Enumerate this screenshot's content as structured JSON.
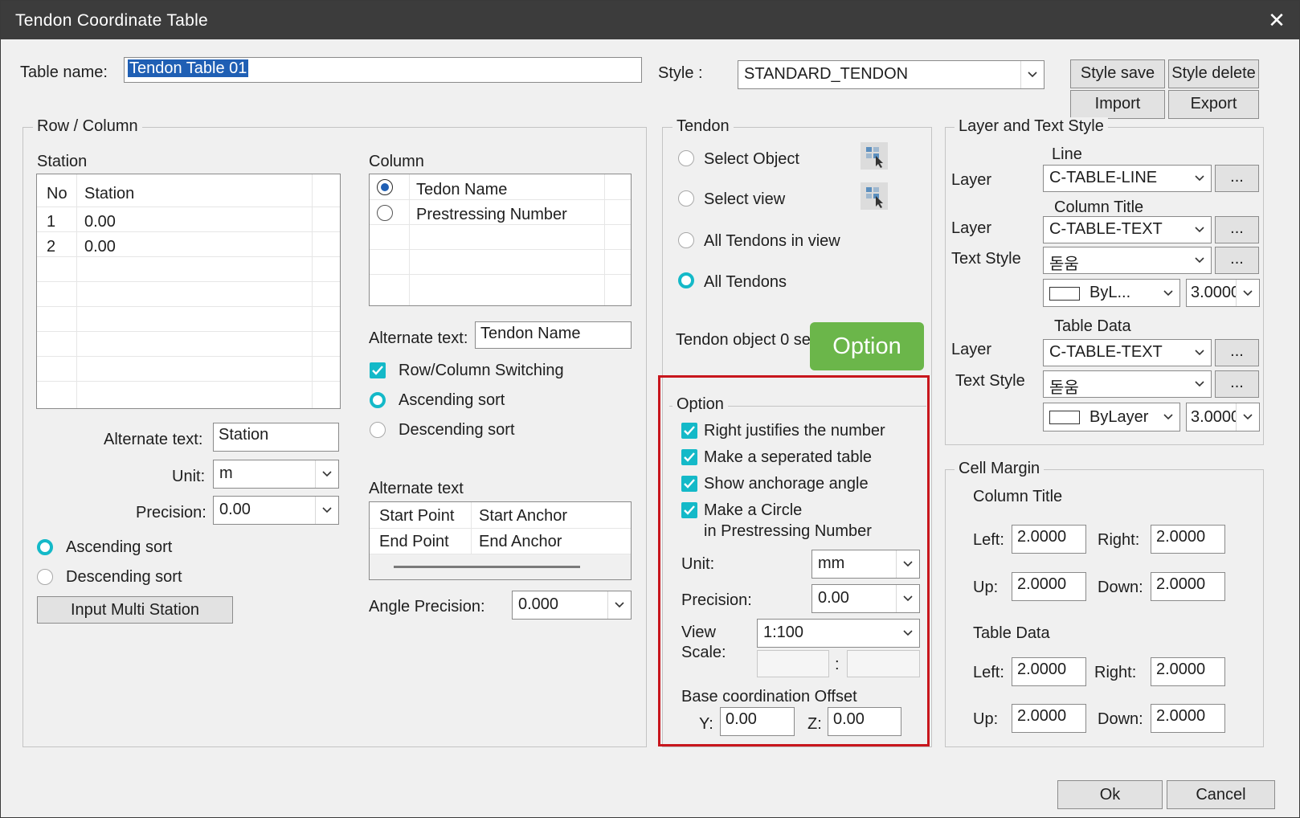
{
  "window": {
    "title": "Tendon Coordinate Table",
    "close_glyph": "✕"
  },
  "header": {
    "table_name_label": "Table name:",
    "table_name_value": "Tendon Table 01",
    "style_label": "Style :",
    "style_value": "STANDARD_TENDON",
    "buttons": {
      "style_save": "Style save",
      "style_delete": "Style delete",
      "import": "Import",
      "export": "Export"
    }
  },
  "row_column": {
    "legend": "Row / Column",
    "station": {
      "label": "Station",
      "headers": [
        "No",
        "Station"
      ],
      "rows": [
        [
          "1",
          "0.00"
        ],
        [
          "2",
          "0.00"
        ]
      ],
      "alt_text_label": "Alternate text:",
      "alt_text_value": "Station",
      "unit_label": "Unit:",
      "unit_value": "m",
      "precision_label": "Precision:",
      "precision_value": "0.00",
      "ascending": "Ascending sort",
      "descending": "Descending sort",
      "input_multi_station": "Input Multi Station"
    },
    "column": {
      "label": "Column",
      "items": [
        "Tedon Name",
        "Prestressing Number"
      ],
      "alt_text_label": "Alternate text:",
      "alt_text_value": "Tendon Name",
      "row_col_switching": "Row/Column Switching",
      "ascending": "Ascending sort",
      "descending": "Descending sort",
      "alt_text_section_label": "Alternate text",
      "alt_table": [
        [
          "Start Point",
          "Start Anchor"
        ],
        [
          "End Point",
          "End Anchor"
        ]
      ],
      "angle_precision_label": "Angle Precision:",
      "angle_precision_value": "0.000"
    }
  },
  "tendon": {
    "legend": "Tendon",
    "select_object": "Select Object",
    "select_view": "Select view",
    "all_in_view": "All Tendons in view",
    "all_tendons": "All Tendons",
    "status": "Tendon object 0 se"
  },
  "option": {
    "badge": "Option",
    "legend": "Option",
    "right_justify": "Right justifies the number",
    "separated_table": "Make a seperated table",
    "anchorage_angle": "Show anchorage angle",
    "circle_line1": "Make a Circle",
    "circle_line2": "in Prestressing Number",
    "unit_label": "Unit:",
    "unit_value": "mm",
    "precision_label": "Precision:",
    "precision_value": "0.00",
    "view_label_1": "View",
    "view_label_2": "Scale:",
    "view_scale_value": "1:100",
    "ratio_sep": ":",
    "base_offset_label": "Base coordination Offset",
    "y_label": "Y:",
    "y_value": "0.00",
    "z_label": "Z:",
    "z_value": "0.00"
  },
  "layer_text": {
    "legend": "Layer and Text Style",
    "line_label": "Line",
    "layer_label": "Layer",
    "line_layer": "C-TABLE-LINE",
    "col_title_label": "Column Title",
    "col_layer": "C-TABLE-TEXT",
    "text_style_label": "Text Style",
    "col_text_style": "돋움",
    "col_color": "ByL...",
    "col_height": "3.0000",
    "table_data_label": "Table Data",
    "data_layer": "C-TABLE-TEXT",
    "data_text_style": "돋움",
    "data_color": "ByLayer",
    "data_height": "3.0000",
    "ellipsis": "..."
  },
  "cell_margin": {
    "legend": "Cell Margin",
    "column_title": "Column Title",
    "table_data": "Table Data",
    "left_label": "Left:",
    "right_label": "Right:",
    "up_label": "Up:",
    "down_label": "Down:",
    "ct": {
      "left": "2.0000",
      "right": "2.0000",
      "up": "2.0000",
      "down": "2.0000"
    },
    "td": {
      "left": "2.0000",
      "right": "2.0000",
      "up": "2.0000",
      "down": "2.0000"
    }
  },
  "footer": {
    "ok": "Ok",
    "cancel": "Cancel"
  },
  "colors": {
    "titlebar": "#3c3c3c",
    "accent_teal": "#14b9c8",
    "highlight_red": "#c8161d",
    "badge_green": "#6bb64a",
    "selection_blue": "#1f5fb4"
  }
}
